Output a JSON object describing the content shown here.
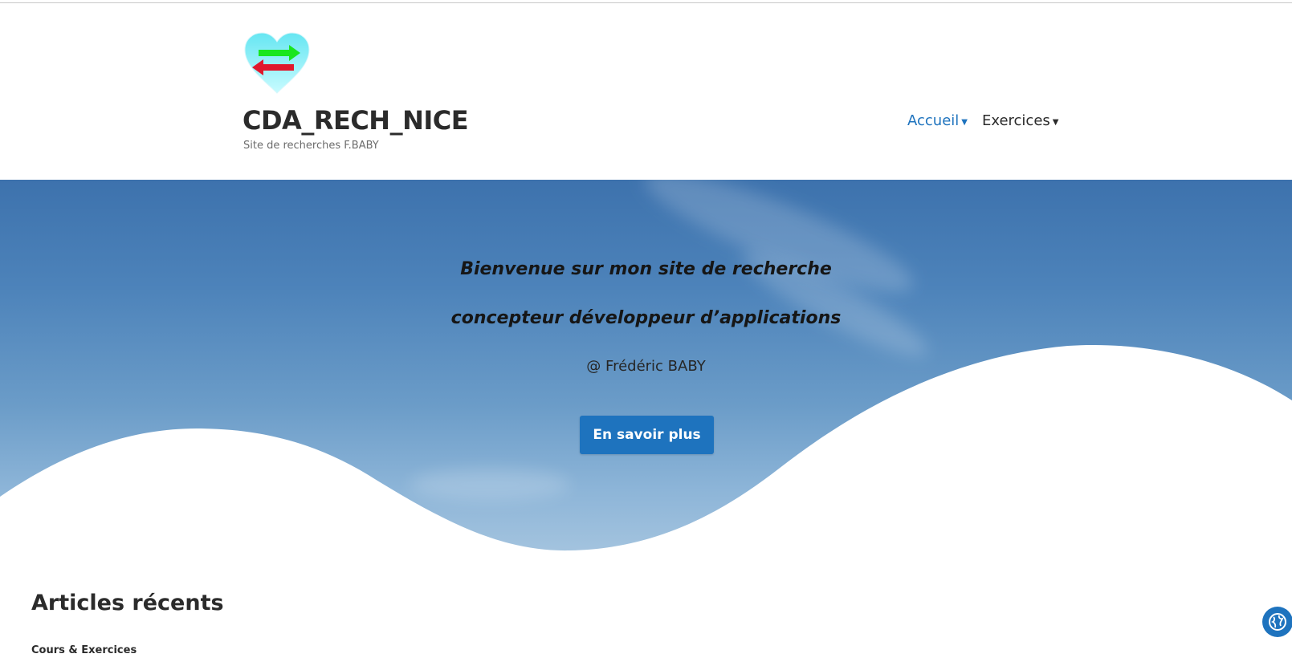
{
  "header": {
    "site_title": "CDA_RECH_NICE",
    "tagline": "Site de recherches F.BABY"
  },
  "nav": {
    "items": [
      {
        "label": "Accueil",
        "active": true
      },
      {
        "label": "Exercices",
        "active": false
      }
    ]
  },
  "hero": {
    "line1": "Bienvenue sur mon site de recherche",
    "line2": "concepteur développeur d’applications",
    "author": "@ Frédéric BABY",
    "button_label": "En savoir plus"
  },
  "recent": {
    "heading": "Articles récents",
    "items": [
      "Cours & Exercices"
    ]
  },
  "icons": {
    "logo": "heart-arrows-logo",
    "nav_caret": "caret-down-icon",
    "accessibility": "globe-accessibility-icon"
  },
  "colors": {
    "accent": "#1e73be",
    "text": "#2b2b2b",
    "tagline": "#6c6c6c",
    "hero_sky": "#4d83ba"
  }
}
